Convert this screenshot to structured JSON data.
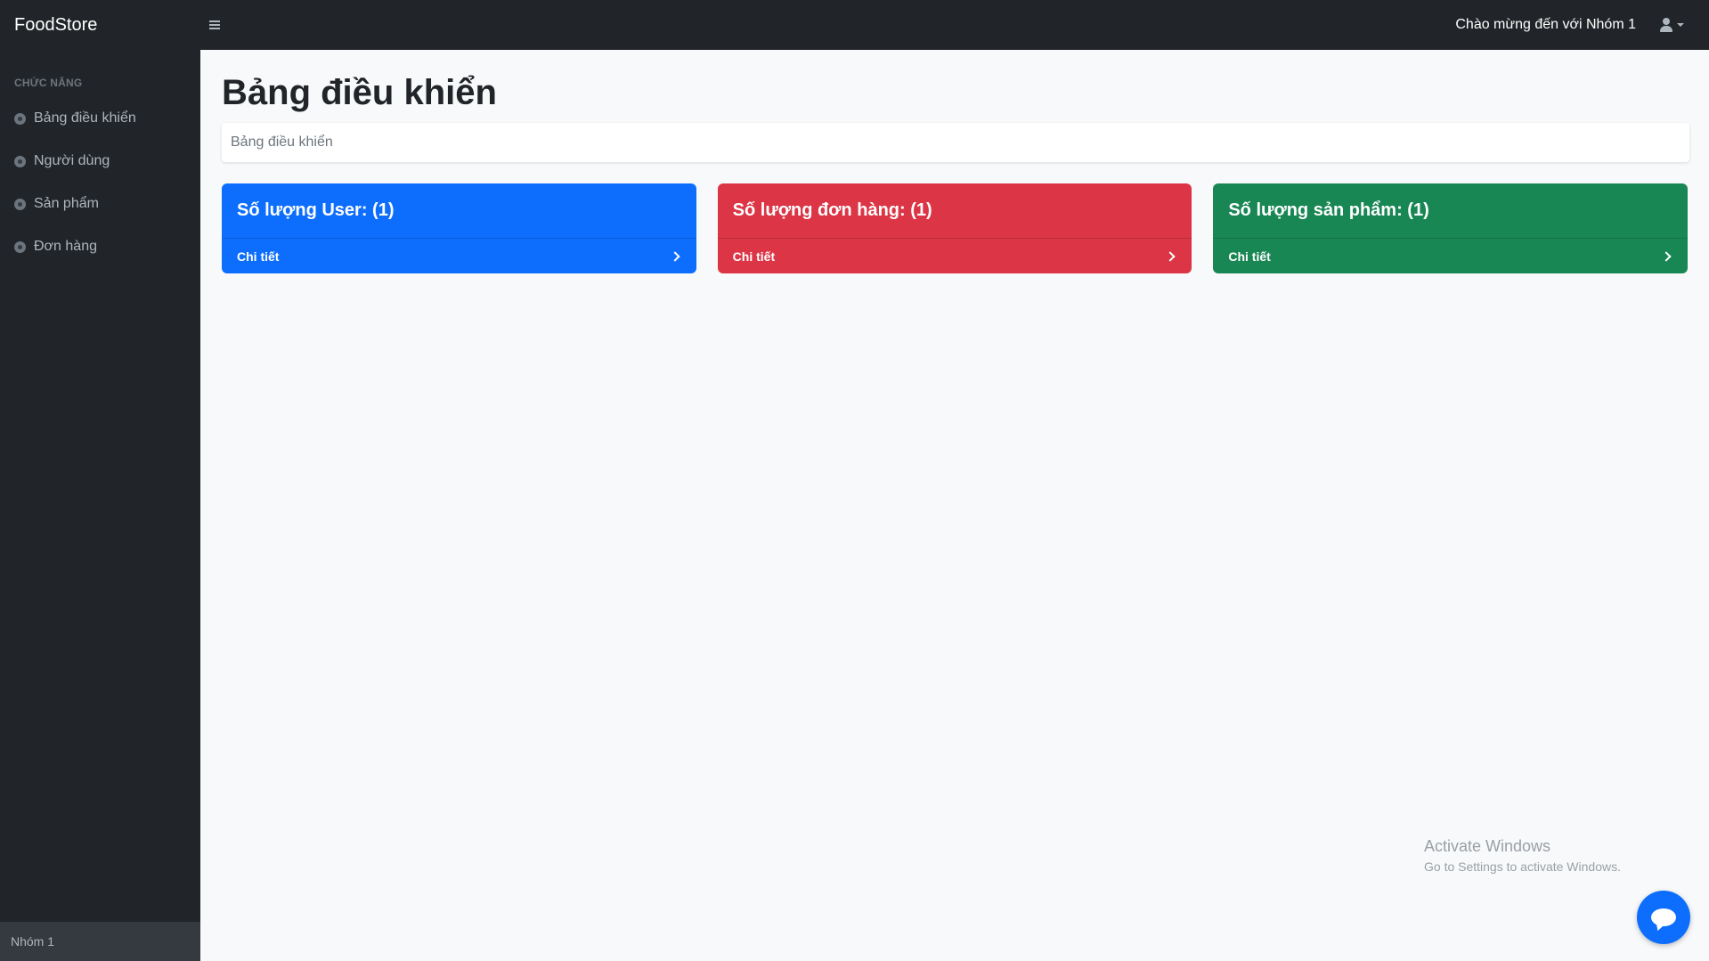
{
  "app": {
    "brand": "FoodStore"
  },
  "topbar": {
    "welcome": "Chào mừng đến với Nhóm 1",
    "user_icon": "user-icon"
  },
  "sidebar": {
    "heading": "CHỨC NĂNG",
    "items": [
      {
        "label": "Bảng điều khiển",
        "icon": "tachometer-icon"
      },
      {
        "label": "Người dùng",
        "icon": "tachometer-icon"
      },
      {
        "label": "Sản phẩm",
        "icon": "tachometer-icon"
      },
      {
        "label": "Đơn hàng",
        "icon": "tachometer-icon"
      }
    ],
    "footer": "Nhóm 1"
  },
  "main": {
    "title": "Bảng điều khiển",
    "breadcrumb": "Bảng điều khiển",
    "cards": [
      {
        "title": "Số lượng User: (1)",
        "link": "Chi tiết",
        "color": "#0d6efd"
      },
      {
        "title": "Số lượng đơn hàng: (1)",
        "link": "Chi tiết",
        "color": "#dc3545"
      },
      {
        "title": "Số lượng sản phẩm: (1)",
        "link": "Chi tiết",
        "color": "#198754"
      }
    ]
  },
  "watermark": {
    "line1": "Activate Windows",
    "line2": "Go to Settings to activate Windows."
  },
  "chat": {
    "icon": "chat-bubble-icon",
    "color": "#0d6efd"
  }
}
